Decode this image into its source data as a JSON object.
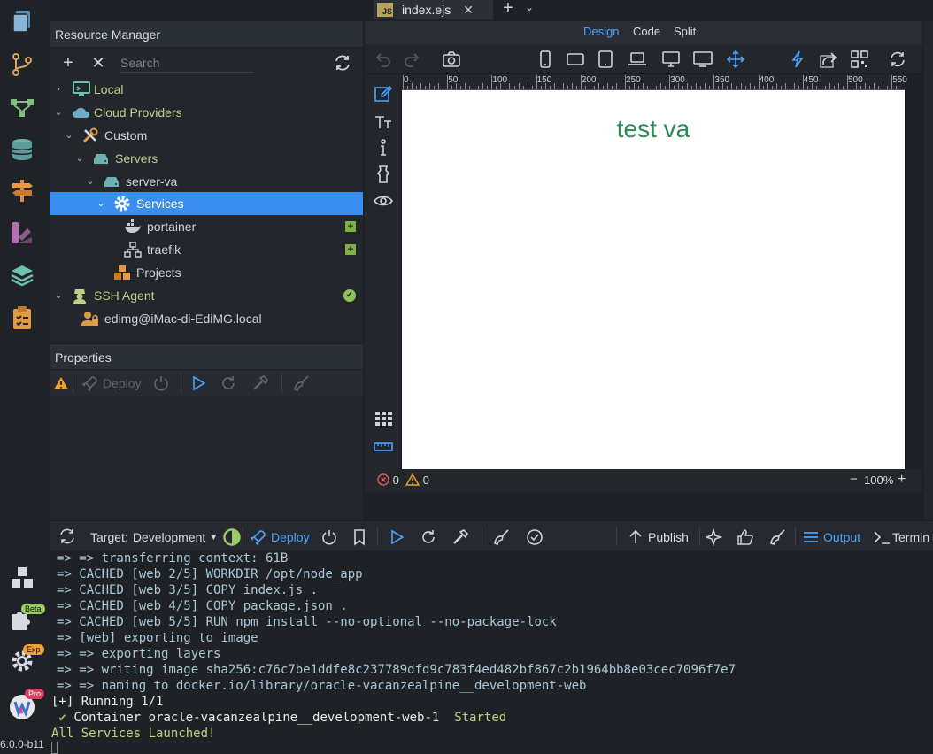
{
  "activity": {
    "version": "6.0.0-b11",
    "badges": {
      "beta": "Beta",
      "exp": "Exp",
      "pro": "Pro"
    },
    "icons": [
      "files-icon",
      "git-branch-icon",
      "graph-icon",
      "database-icon",
      "signpost-icon",
      "palette-icon",
      "layers-icon",
      "clipboard-icon",
      "packages-icon",
      "plugins-icon",
      "settings-icon",
      "app-logo-icon"
    ]
  },
  "resource_manager": {
    "title": "Resource Manager",
    "search_placeholder": "Search",
    "tree": [
      {
        "label": "Local",
        "icon": "monitor-icon"
      },
      {
        "label": "Cloud Providers",
        "icon": "cloud-icon"
      },
      {
        "label": "Custom",
        "icon": "tools-icon"
      },
      {
        "label": "Servers",
        "icon": "server-stack-icon"
      },
      {
        "label": "server-va",
        "icon": "server-icon"
      },
      {
        "label": "Services",
        "icon": "gear-icon"
      },
      {
        "label": "portainer",
        "icon": "docker-icon"
      },
      {
        "label": "traefik",
        "icon": "network-icon"
      },
      {
        "label": "Projects",
        "icon": "boxes-icon"
      },
      {
        "label": "SSH Agent",
        "icon": "agent-icon"
      },
      {
        "label": "edimg@iMac-di-EdiMG.local",
        "icon": "user-lock-icon"
      }
    ]
  },
  "properties": {
    "title": "Properties",
    "deploy_label": "Deploy"
  },
  "editor": {
    "tab_label": "index.ejs",
    "tab_badge": "JS",
    "modes": [
      "Design",
      "Code",
      "Split"
    ],
    "active_mode": "Design",
    "ruler": [
      "0",
      "50",
      "100",
      "150",
      "200",
      "250",
      "300",
      "350",
      "400",
      "450",
      "500",
      "550"
    ],
    "canvas_text": "test va",
    "errors": "0",
    "warnings": "0",
    "zoom": "100%",
    "zoom_minus": "−",
    "zoom_plus": "+"
  },
  "bottom": {
    "target_label": "Target:",
    "target_value": "Development",
    "deploy_label": "Deploy",
    "publish_label": "Publish",
    "output_label": "Output",
    "terminal_label": "Termin"
  },
  "console": {
    "lines": [
      "=> => transferring context: 61B",
      "=> CACHED [web 2/5] WORKDIR /opt/node_app",
      "=> CACHED [web 3/5] COPY index.js .",
      "=> CACHED [web 4/5] COPY package.json .",
      "=> CACHED [web 5/5] RUN npm install --no-optional --no-package-lock",
      "=> [web] exporting to image",
      "=> => exporting layers",
      "=> => writing image sha256:c76c7be1ddfe8c237789dfd9c783f4ed482bf867c2b1964bb8e03cec7096f7e7",
      "=> => naming to docker.io/library/oracle-vacanzealpine__development-web"
    ],
    "running": "[+] Running 1/1",
    "container_check": "✔",
    "container": "Container oracle-vacanzealpine__development-web-1",
    "container_status": "Started",
    "launched": "All Services Launched!"
  }
}
